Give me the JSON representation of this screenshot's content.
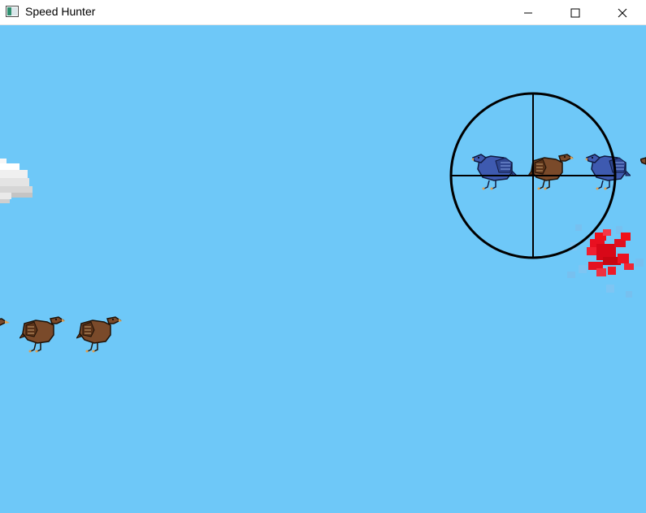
{
  "window": {
    "title": "Speed Hunter",
    "icons": {
      "app": "app-window-icon",
      "minimize": "minimize-icon",
      "maximize": "maximize-icon",
      "close": "close-icon"
    }
  },
  "scene": {
    "sky_color": "#6ec8f8",
    "birds": [
      {
        "kind": "brown",
        "color": "#7a4a2a"
      },
      {
        "kind": "brown",
        "color": "#7a4a2a"
      },
      {
        "kind": "brown",
        "color": "#7a4a2a"
      },
      {
        "kind": "blue",
        "color": "#3e5ab0"
      },
      {
        "kind": "brown",
        "color": "#7a4a2a"
      },
      {
        "kind": "blue",
        "color": "#3e5ab0"
      },
      {
        "kind": "partial",
        "color": "#7a4a2a"
      }
    ],
    "crosshair": {
      "color": "#000000"
    },
    "blood_splat": {
      "color": "#e8101e"
    },
    "cloud": {
      "color": "#f2f2f2"
    }
  }
}
